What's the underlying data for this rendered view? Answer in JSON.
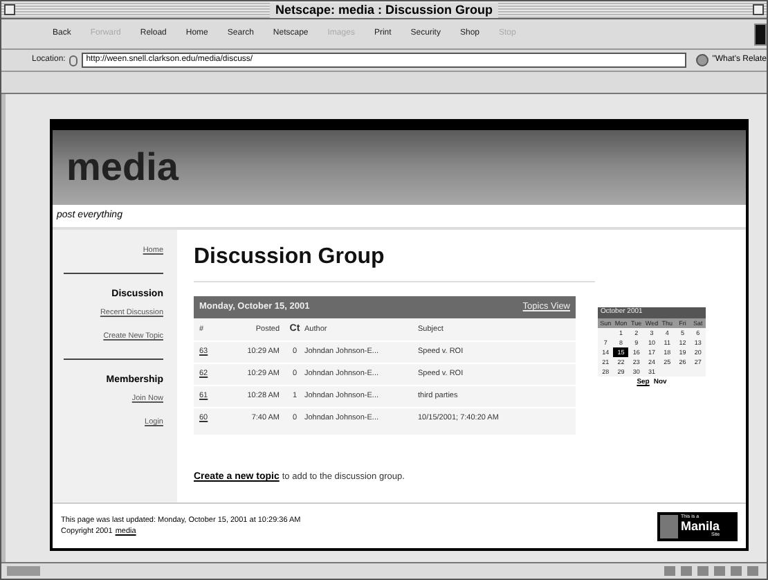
{
  "window": {
    "title": "Netscape: media : Discussion Group"
  },
  "toolbar": [
    {
      "label": "Back",
      "disabled": false
    },
    {
      "label": "Forward",
      "disabled": true
    },
    {
      "label": "Reload",
      "disabled": false
    },
    {
      "label": "Home",
      "disabled": false
    },
    {
      "label": "Search",
      "disabled": false
    },
    {
      "label": "Netscape",
      "disabled": false
    },
    {
      "label": "Images",
      "disabled": true
    },
    {
      "label": "Print",
      "disabled": false
    },
    {
      "label": "Security",
      "disabled": false
    },
    {
      "label": "Shop",
      "disabled": false
    },
    {
      "label": "Stop",
      "disabled": true
    }
  ],
  "location": {
    "label": "Location:",
    "url": "http://ween.snell.clarkson.edu/media/discuss/",
    "related": "\"What's Relate"
  },
  "site": {
    "name": "media",
    "tagline": "post everything"
  },
  "sidebar": [
    {
      "kind": "link",
      "label": "Home"
    },
    {
      "kind": "rule"
    },
    {
      "kind": "heading",
      "label": "Discussion"
    },
    {
      "kind": "link",
      "label": "Recent Discussion"
    },
    {
      "kind": "link",
      "label": "Create New Topic"
    },
    {
      "kind": "rule"
    },
    {
      "kind": "heading",
      "label": "Membership"
    },
    {
      "kind": "link",
      "label": "Join Now"
    },
    {
      "kind": "link",
      "label": "Login"
    }
  ],
  "heading": "Discussion Group",
  "table": {
    "date": "Monday, October 15, 2001",
    "view_link": "Topics View",
    "columns": [
      "#",
      "Posted",
      "Ct",
      "Author",
      "Subject"
    ],
    "rows": [
      [
        "63",
        "10:29 AM",
        "0",
        "Johndan Johnson-E...",
        "Speed v. ROI"
      ],
      [
        "62",
        "10:29 AM",
        "0",
        "Johndan Johnson-E...",
        "Speed v. ROI"
      ],
      [
        "61",
        "10:28 AM",
        "1",
        "Johndan Johnson-E...",
        "third parties"
      ],
      [
        "60",
        "7:40 AM",
        "0",
        "Johndan Johnson-E...",
        "10/15/2001; 7:40:20 AM"
      ]
    ]
  },
  "calendar": {
    "month": "October 2001",
    "weekdays": [
      "Sun",
      "Mon",
      "Tue",
      "Wed",
      "Thu",
      "Fri",
      "Sat"
    ],
    "weeks": [
      [
        {
          "label": "1",
          "selected": false
        },
        {
          "label": "2",
          "selected": false
        },
        {
          "label": "3",
          "selected": false
        },
        {
          "label": "4",
          "selected": false
        },
        {
          "label": "5",
          "selected": false
        },
        {
          "label": "6",
          "selected": false
        }
      ],
      [
        {
          "label": "7",
          "selected": false
        },
        {
          "label": "8",
          "selected": false
        },
        {
          "label": "9",
          "selected": false
        },
        {
          "label": "10",
          "selected": false
        },
        {
          "label": "11",
          "selected": false
        },
        {
          "label": "12",
          "selected": false
        },
        {
          "label": "13",
          "selected": false
        }
      ],
      [
        {
          "label": "14",
          "selected": false
        },
        {
          "label": "15",
          "selected": true
        },
        {
          "label": "16",
          "selected": false
        },
        {
          "label": "17",
          "selected": false
        },
        {
          "label": "18",
          "selected": false
        },
        {
          "label": "19",
          "selected": false
        },
        {
          "label": "20",
          "selected": false
        }
      ],
      [
        {
          "label": "21",
          "selected": false
        },
        {
          "label": "22",
          "selected": false
        },
        {
          "label": "23",
          "selected": false
        },
        {
          "label": "24",
          "selected": false
        },
        {
          "label": "25",
          "selected": false
        },
        {
          "label": "26",
          "selected": false
        },
        {
          "label": "27",
          "selected": false
        }
      ],
      [
        {
          "label": "28",
          "selected": false
        },
        {
          "label": "29",
          "selected": false
        },
        {
          "label": "30",
          "selected": false
        },
        {
          "label": "31",
          "selected": false
        }
      ]
    ],
    "prev": "Sep",
    "next": "Nov"
  },
  "create": {
    "link": "Create a new topic",
    "rest": "to add to the discussion group."
  },
  "footer": {
    "updated": "This page was last updated: Monday, October 15, 2001 at 10:29:36 AM",
    "copyright": "Copyright 2001",
    "copyright_link": "media",
    "badge": {
      "top": "This is a",
      "name": "Manila",
      "bottom": "Site"
    }
  }
}
